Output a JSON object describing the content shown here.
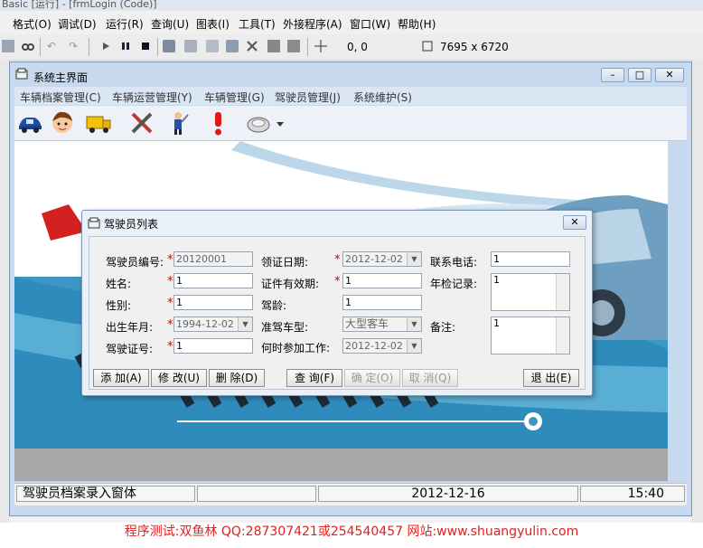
{
  "ide": {
    "title": "Basic [运行] - [frmLogin (Code)]",
    "menu": [
      "格式(O)",
      "调试(D)",
      "运行(R)",
      "查询(U)",
      "图表(I)",
      "工具(T)",
      "外接程序(A)",
      "窗口(W)",
      "帮助(H)"
    ],
    "position": "0, 0",
    "size": "7695 x 6720",
    "footer": "程序测试:双鱼林 QQ:287307421或254540457 网站:www.shuangyulin.com"
  },
  "main": {
    "title": "系统主界面",
    "menu": [
      "车辆档案管理(C)",
      "车辆运营管理(Y)",
      "车辆管理(G)",
      "驾驶员管理(J)",
      "系统维护(S)"
    ],
    "status": {
      "text": "驾驶员档案录入窗体",
      "date": "2012-12-16",
      "time": "15:40"
    }
  },
  "dialog": {
    "title": "驾驶员列表",
    "labels": {
      "driver_no": "驾驶员编号:",
      "name": "姓名:",
      "gender": "性别:",
      "birth": "出生年月:",
      "license_no": "驾驶证号:",
      "issue_date": "领证日期:",
      "valid_period": "证件有效期:",
      "driving_age": "驾龄:",
      "vehicle_type": "准驾车型:",
      "work_start": "何时参加工作:",
      "phone": "联系电话:",
      "inspection": "年检记录:",
      "remark": "备注:"
    },
    "required": "*",
    "values": {
      "driver_no": "20120001",
      "name": "1",
      "gender": "1",
      "birth": "1994-12-02",
      "license_no": "1",
      "issue_date": "2012-12-02",
      "valid_period": "1",
      "driving_age": "1",
      "vehicle_type": "大型客车",
      "work_start": "2012-12-02",
      "phone": "1",
      "inspection": "1",
      "remark": "1"
    },
    "buttons": {
      "add": "添 加(A)",
      "edit": "修 改(U)",
      "delete": "删 除(D)",
      "query": "查 询(F)",
      "confirm": "确 定(O)",
      "cancel": "取 消(Q)",
      "exit": "退 出(E)"
    }
  }
}
